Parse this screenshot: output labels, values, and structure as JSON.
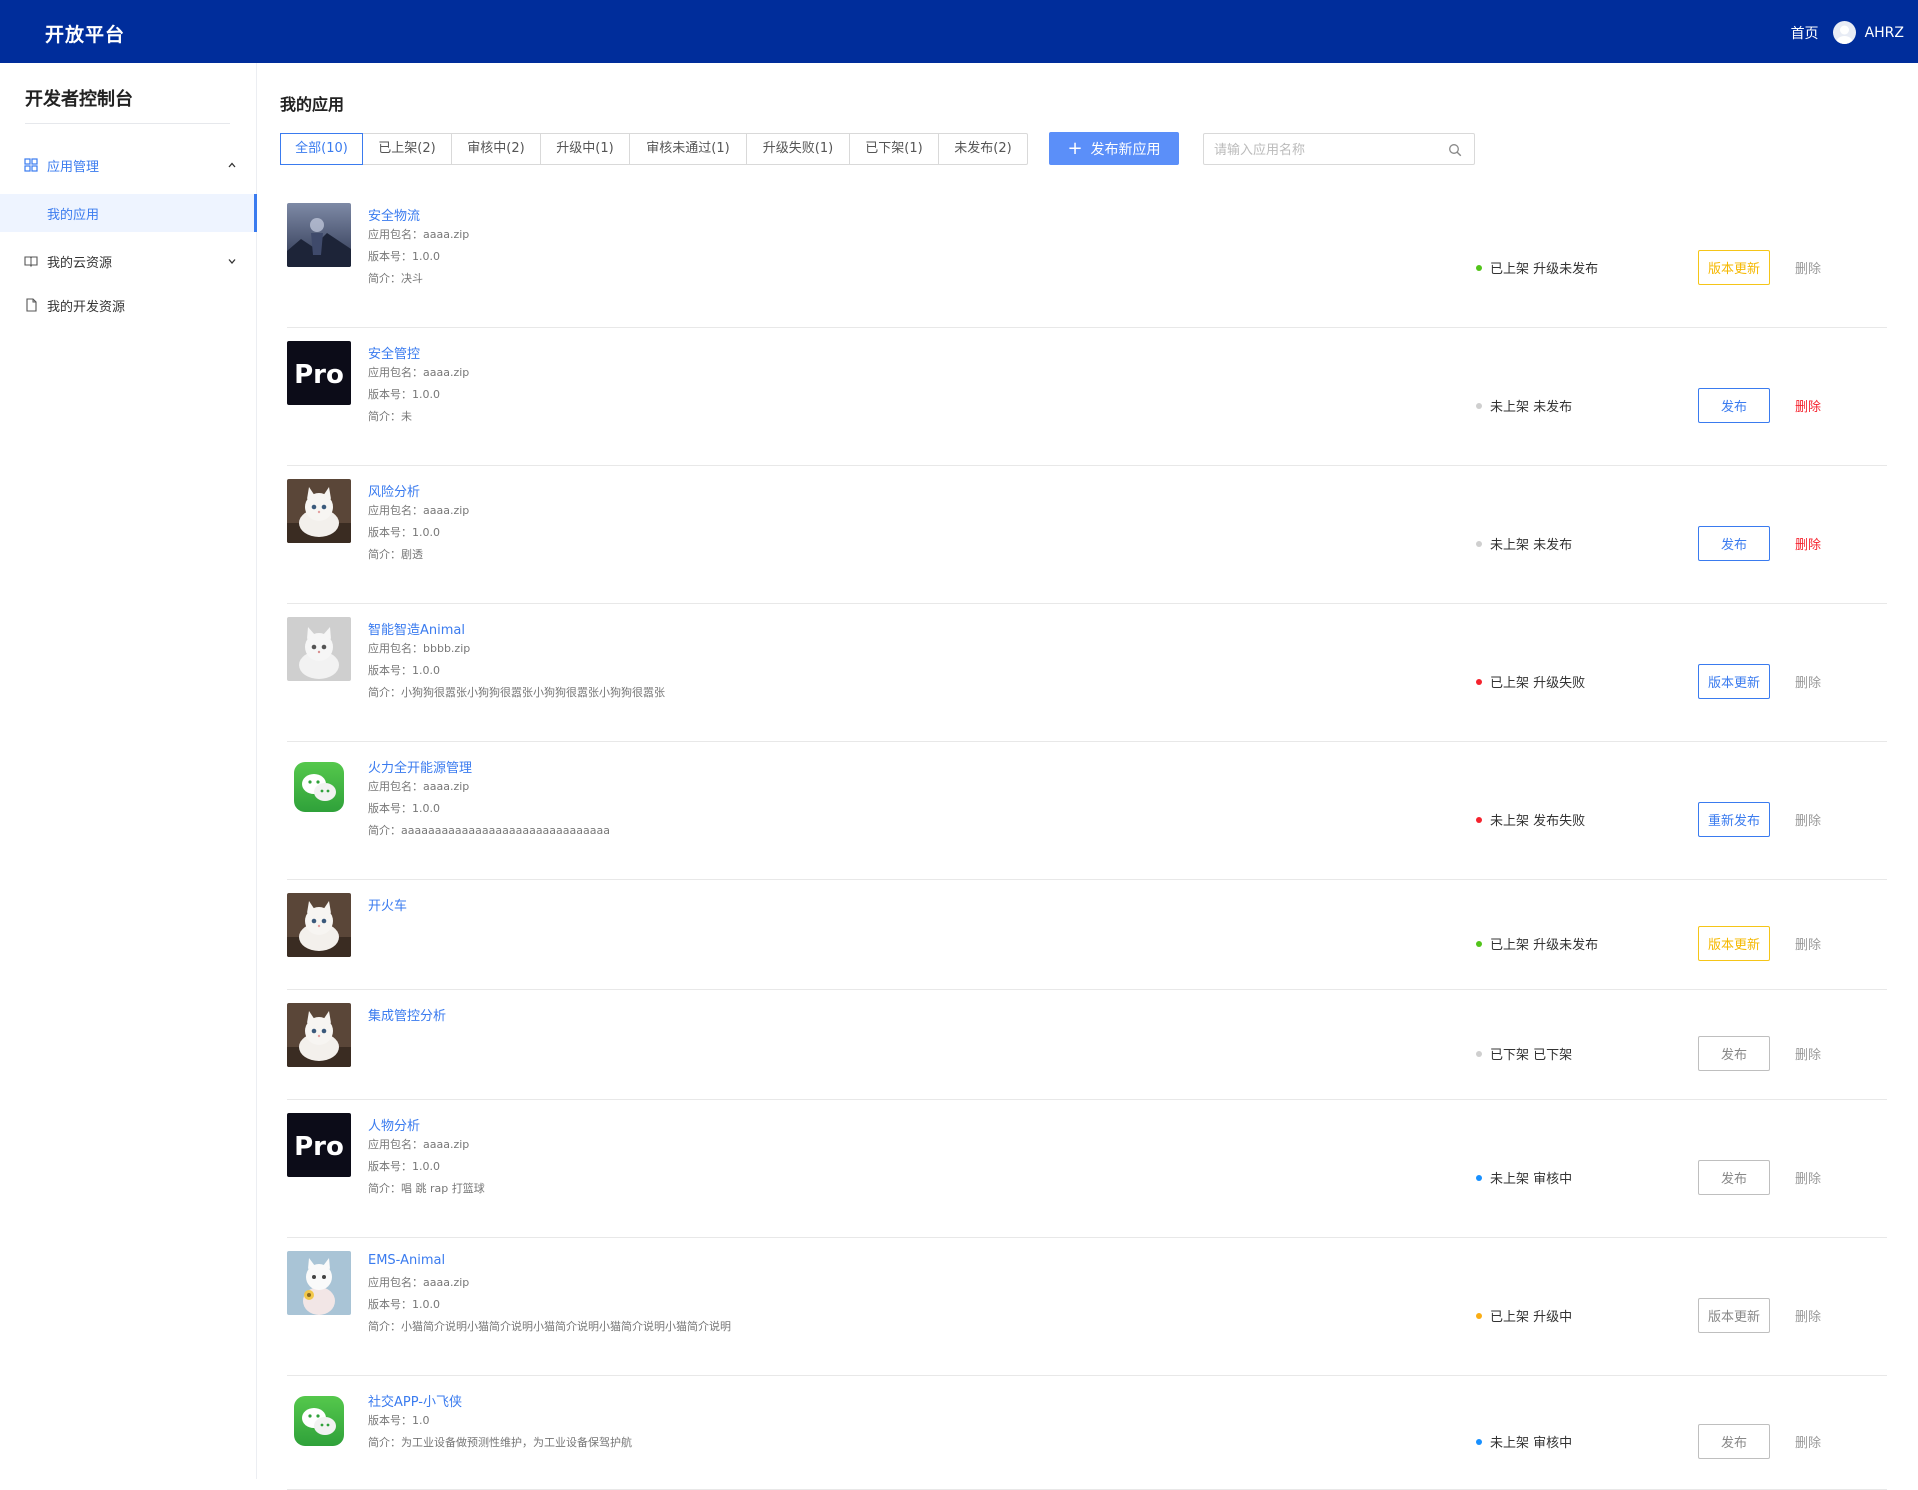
{
  "header": {
    "brand": "开放平台",
    "home": "首页",
    "user": "AHRZ"
  },
  "sidebar": {
    "title": "开发者控制台",
    "items": [
      {
        "label": "应用管理",
        "icon": "grid-icon"
      },
      {
        "label": "我的应用"
      },
      {
        "label": "我的云资源",
        "icon": "book-icon"
      },
      {
        "label": "我的开发资源",
        "icon": "file-icon"
      }
    ]
  },
  "main": {
    "title": "我的应用",
    "tabs": [
      {
        "label": "全部(10)"
      },
      {
        "label": "已上架(2)"
      },
      {
        "label": "审核中(2)"
      },
      {
        "label": "升级中(1)"
      },
      {
        "label": "审核未通过(1)"
      },
      {
        "label": "升级失败(1)"
      },
      {
        "label": "已下架(1)"
      },
      {
        "label": "未发布(2)"
      }
    ],
    "publish_label": "发布新应用",
    "search_placeholder": "请输入应用名称"
  },
  "colors": {
    "green": "#52c41a",
    "red": "#f5222d",
    "grey": "#cfcfcf",
    "blue": "#1890ff",
    "orange": "#faad14",
    "accent": "#3a7bef",
    "brand": "#002d9b"
  },
  "apps": [
    {
      "name": "安全物流",
      "thumb": "landscape",
      "meta": [
        "应用包名：aaaa.zip",
        "版本号：1.0.0",
        "简介：决斗"
      ],
      "status": "已上架 升级未发布",
      "dot": "green",
      "action": "版本更新",
      "action_style": "warn",
      "delete": "删除",
      "delete_style": "grey"
    },
    {
      "name": "安全管控",
      "thumb": "pro",
      "meta": [
        "应用包名：aaaa.zip",
        "版本号：1.0.0",
        "简介：未"
      ],
      "status": "未上架 未发布",
      "dot": "grey",
      "action": "发布",
      "action_style": "blue",
      "delete": "删除",
      "delete_style": "red"
    },
    {
      "name": "风险分析",
      "thumb": "cat",
      "meta": [
        "应用包名：aaaa.zip",
        "版本号：1.0.0",
        "简介：剧透"
      ],
      "status": "未上架 未发布",
      "dot": "grey",
      "action": "发布",
      "action_style": "blue",
      "delete": "删除",
      "delete_style": "red"
    },
    {
      "name": "智能智造Animal",
      "thumb": "cat2",
      "meta": [
        "应用包名：bbbb.zip",
        "版本号：1.0.0",
        "简介：小狗狗很嚣张小狗狗很嚣张小狗狗很嚣张小狗狗很嚣张"
      ],
      "status": "已上架 升级失败",
      "dot": "red",
      "action": "版本更新",
      "action_style": "blue",
      "delete": "删除",
      "delete_style": "grey"
    },
    {
      "name": "火力全开能源管理",
      "thumb": "wechat",
      "meta": [
        "应用包名：aaaa.zip",
        "版本号：1.0.0",
        "简介：aaaaaaaaaaaaaaaaaaaaaaaaaaaaaaa"
      ],
      "status": "未上架 发布失败",
      "dot": "red",
      "action": "重新发布",
      "action_style": "blue",
      "delete": "删除",
      "delete_style": "grey"
    },
    {
      "name": "开火车",
      "thumb": "cat",
      "meta": [],
      "status": "已上架 升级未发布",
      "dot": "green",
      "action": "版本更新",
      "action_style": "warn",
      "delete": "删除",
      "delete_style": "grey"
    },
    {
      "name": "集成管控分析",
      "thumb": "cat",
      "meta": [],
      "status": "已下架 已下架",
      "dot": "grey",
      "action": "发布",
      "action_style": "grey",
      "delete": "删除",
      "delete_style": "grey"
    },
    {
      "name": "人物分析",
      "thumb": "pro",
      "meta": [
        "应用包名：aaaa.zip",
        "版本号：1.0.0",
        "简介：唱 跳 rap 打篮球"
      ],
      "status": "未上架 审核中",
      "dot": "blue",
      "action": "发布",
      "action_style": "grey",
      "delete": "删除",
      "delete_style": "grey"
    },
    {
      "name": "EMS-Animal",
      "thumb": "cat3",
      "meta": [
        "应用包名：aaaa.zip",
        "版本号：1.0.0",
        "简介：小猫简介说明小猫简介说明小猫简介说明小猫简介说明小猫简介说明"
      ],
      "status": "已上架 升级中",
      "dot": "orange",
      "action": "版本更新",
      "action_style": "grey",
      "delete": "删除",
      "delete_style": "grey"
    },
    {
      "name": "社交APP-小飞侠",
      "thumb": "wechat",
      "meta": [
        "版本号：1.0",
        "简介：为工业设备做预测性维护，为工业设备保驾护航"
      ],
      "status": "未上架 审核中",
      "dot": "blue",
      "action": "发布",
      "action_style": "grey",
      "delete": "删除",
      "delete_style": "grey"
    }
  ]
}
